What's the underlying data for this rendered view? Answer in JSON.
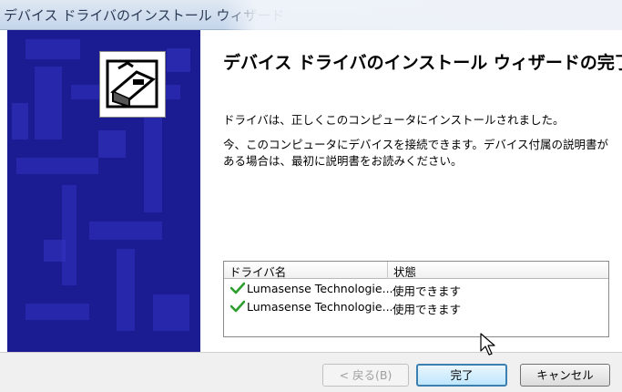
{
  "window": {
    "title": "デバイス ドライバのインストール ウィザード"
  },
  "wizard": {
    "heading": "デバイス ドライバのインストール ウィザードの完了",
    "message_installed": "ドライバは、正しくこのコンピュータにインストールされました。",
    "message_connect": "今、このコンピュータにデバイスを接続できます。デバイス付属の説明書がある場合は、最初に説明書をお読みください。"
  },
  "driver_list": {
    "columns": [
      "ドライバ名",
      "状態"
    ],
    "rows": [
      {
        "name": "Lumasense Technologie...",
        "status": "使用できます",
        "icon": "green-check-icon"
      },
      {
        "name": "Lumasense Technologie...",
        "status": "使用できます",
        "icon": "green-check-icon"
      }
    ]
  },
  "buttons": {
    "back": "< 戻る(B)",
    "finish": "完了",
    "cancel": "キャンセル"
  },
  "colors": {
    "side_panel": "#1a1a8f",
    "check": "#2e9e2e",
    "finish_border": "#3c7fb1"
  }
}
